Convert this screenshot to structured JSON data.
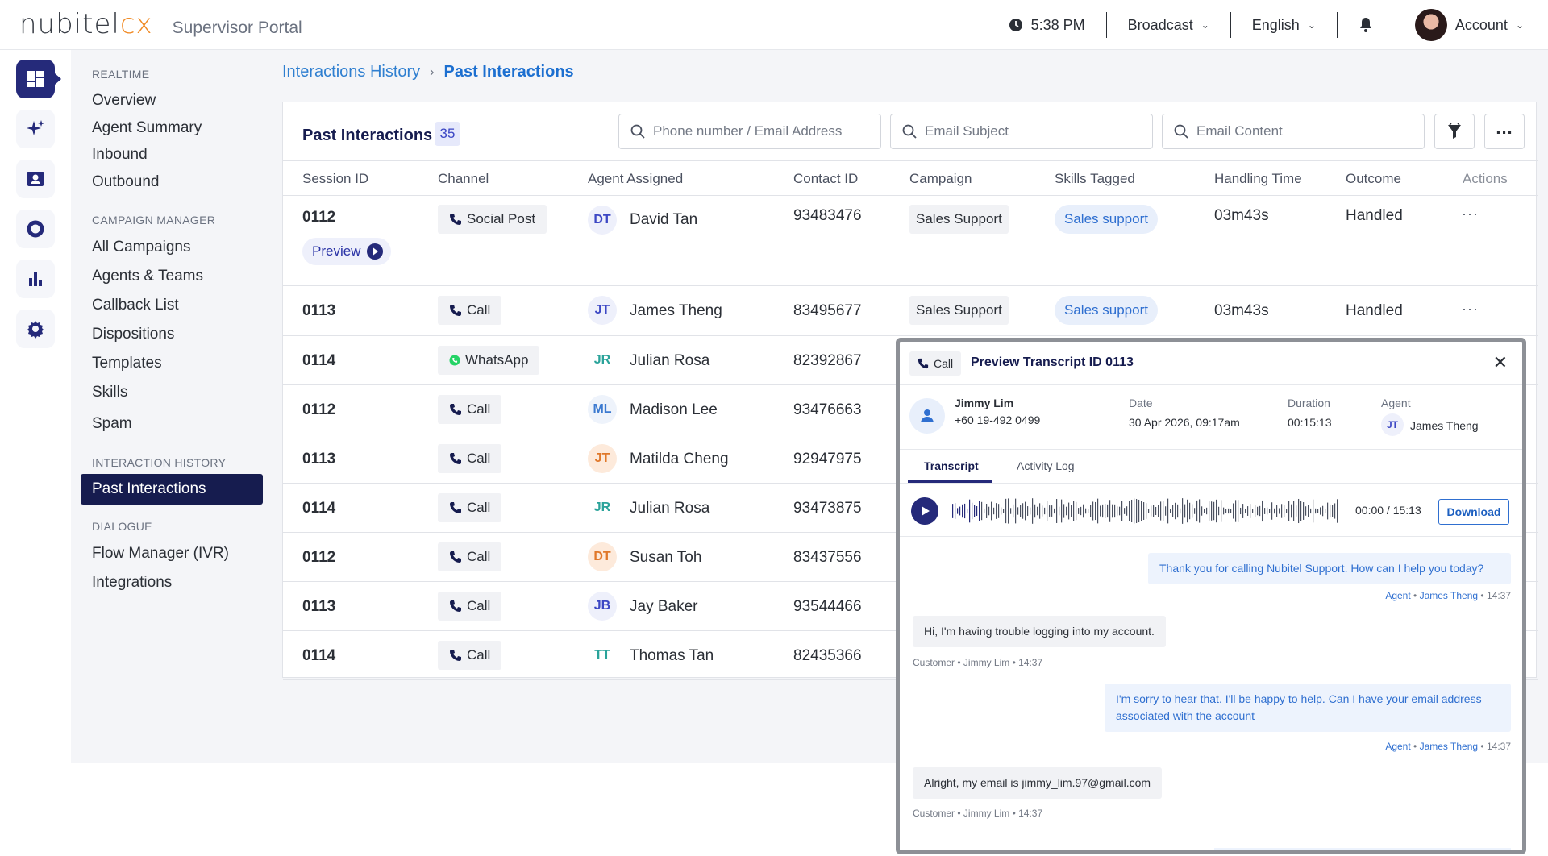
{
  "brand": {
    "logo_a": "nubitel",
    "logo_b": "cx",
    "portal": "Supervisor Portal",
    "accent": "#f08a24",
    "primary": "#252a7a"
  },
  "header": {
    "time": "5:38 PM",
    "broadcast": "Broadcast",
    "language": "English",
    "account": "Account"
  },
  "rail": {
    "items": [
      "dashboard-icon",
      "sparkle-icon",
      "contact-card-icon",
      "donut-icon",
      "bar-chart-icon",
      "gear-icon"
    ]
  },
  "sidenav": {
    "realtime": "REALTIME",
    "overview": "Overview",
    "agent_summary": "Agent Summary",
    "inbound": "Inbound",
    "outbound": "Outbound",
    "campaign_manager": "CAMPAIGN MANAGER",
    "all_campaigns": "All Campaigns",
    "agents_teams": "Agents & Teams",
    "callback_list": "Callback List",
    "dispositions": "Dispositions",
    "templates": "Templates",
    "skills": "Skills",
    "spam": "Spam",
    "interaction_history": "INTERACTION HISTORY",
    "past_interactions": "Past Interactions",
    "dialogue": "DIALOGUE",
    "flow_manager": "Flow Manager (IVR)",
    "integrations": "Integrations"
  },
  "breadcrumb": {
    "parent": "Interactions History",
    "sep": "›",
    "current": "Past Interactions"
  },
  "card": {
    "title": "Past Interactions",
    "count": "35",
    "search_phone_placeholder": "Phone number / Email Address",
    "search_subject_placeholder": "Email Subject",
    "search_content_placeholder": "Email Content"
  },
  "table": {
    "headers": {
      "session": "Session ID",
      "channel": "Channel",
      "agent": "Agent Assigned",
      "contact": "Contact ID",
      "campaign": "Campaign",
      "skills": "Skills Tagged",
      "handling": "Handling Time",
      "outcome": "Outcome",
      "actions": "Actions"
    },
    "preview_label": "Preview",
    "rows": [
      {
        "session": "0112",
        "channel": "Social Post",
        "initials": "DT",
        "agent": "David Tan",
        "contact": "93483476",
        "campaign": "Sales Support",
        "skill": "Sales support",
        "handling": "03m43s",
        "outcome": "Handled"
      },
      {
        "session": "0113",
        "channel": "Call",
        "initials": "JT",
        "agent": "James Theng",
        "contact": "83495677",
        "campaign": "Sales Support",
        "skill": "Sales support",
        "handling": "03m43s",
        "outcome": "Handled"
      },
      {
        "session": "0114",
        "channel": "WhatsApp",
        "initials": "JR",
        "agent": "Julian Rosa",
        "contact": "82392867"
      },
      {
        "session": "0112",
        "channel": "Call",
        "initials": "ML",
        "agent": "Madison Lee",
        "contact": "93476663"
      },
      {
        "session": "0113",
        "channel": "Call",
        "initials": "JT",
        "agent": "Matilda Cheng",
        "contact": "92947975"
      },
      {
        "session": "0114",
        "channel": "Call",
        "initials": "JR",
        "agent": "Julian Rosa",
        "contact": "93473875"
      },
      {
        "session": "0112",
        "channel": "Call",
        "initials": "DT",
        "agent": "Susan Toh",
        "contact": "83437556"
      },
      {
        "session": "0113",
        "channel": "Call",
        "initials": "JB",
        "agent": "Jay Baker",
        "contact": "93544466"
      },
      {
        "session": "0114",
        "channel": "Call",
        "initials": "TT",
        "agent": "Thomas Tan",
        "contact": "82435366"
      }
    ]
  },
  "modal": {
    "channel": "Call",
    "title": "Preview Transcript ID 0113",
    "customer_name": "Jimmy Lim",
    "customer_phone": "+60 19-492 0499",
    "date_label": "Date",
    "date_value": "30 Apr 2026, 09:17am",
    "duration_label": "Duration",
    "duration_value": "00:15:13",
    "agent_label": "Agent",
    "agent_initials": "JT",
    "agent_name": "James Theng",
    "tab_transcript": "Transcript",
    "tab_activity": "Activity Log",
    "player_time": "00:00 / 15:13",
    "download": "Download",
    "messages": [
      {
        "text": "Thank you for calling Nubitel Support. How can I help you today?",
        "role": "Agent",
        "name": "James Theng",
        "time": "14:37"
      },
      {
        "text": "Hi, I'm having trouble logging into my account.",
        "role": "Customer",
        "name": "Jimmy Lim",
        "time": "14:37"
      },
      {
        "text": "I'm sorry to hear that. I'll be happy to help. Can I have your email address associated with the account",
        "role": "Agent",
        "name": "James Theng",
        "time": "14:37"
      },
      {
        "text": "Alright, my email is jimmy_lim.97@gmail.com",
        "role": "Customer",
        "name": "Jimmy Lim",
        "time": "14:37"
      }
    ],
    "dot": "•"
  }
}
